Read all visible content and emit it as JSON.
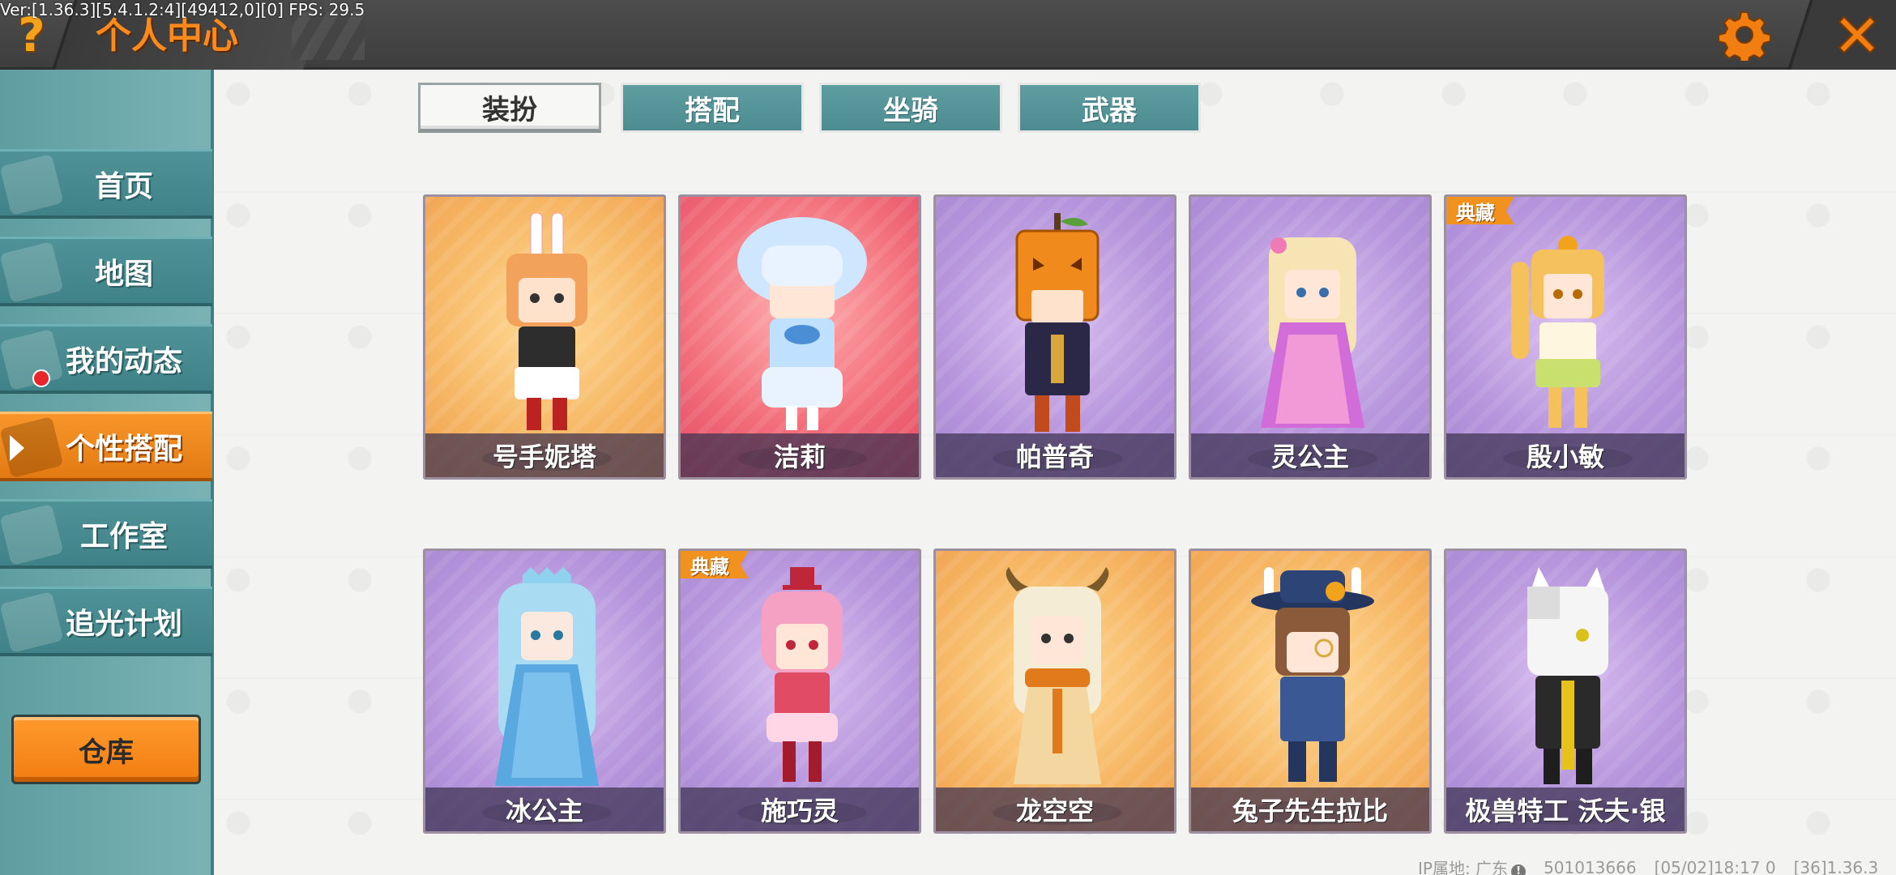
{
  "debug": "Ver:[1.36.3][5.4.1.2:4][49412,0][0] FPS: 29.5",
  "topbar": {
    "help_icon": "?",
    "title": "个人中心",
    "settings_icon": "gear-icon",
    "close_icon": "close-icon"
  },
  "sidebar": {
    "items": [
      {
        "label": "首页",
        "icon": "home-icon"
      },
      {
        "label": "地图",
        "icon": "map-icon"
      },
      {
        "label": "我的动态",
        "icon": "activity-icon"
      },
      {
        "label": "个性搭配",
        "icon": "outfit-icon",
        "active": true
      },
      {
        "label": "工作室",
        "icon": "studio-icon"
      },
      {
        "label": "追光计划",
        "icon": "plan-icon"
      }
    ],
    "warehouse_label": "仓库"
  },
  "tabs": [
    {
      "label": "装扮",
      "active": true
    },
    {
      "label": "搭配"
    },
    {
      "label": "坐骑"
    },
    {
      "label": "武器"
    }
  ],
  "cards": [
    {
      "name": "号手妮塔",
      "theme": "orange"
    },
    {
      "name": "洁莉",
      "theme": "red"
    },
    {
      "name": "帕普奇",
      "theme": "purple"
    },
    {
      "name": "灵公主",
      "theme": "purple"
    },
    {
      "name": "殷小敏",
      "theme": "purple",
      "badge": "典藏"
    },
    {
      "name": "冰公主",
      "theme": "purple"
    },
    {
      "name": "施巧灵",
      "theme": "purple",
      "badge": "典藏"
    },
    {
      "name": "龙空空",
      "theme": "orange"
    },
    {
      "name": "兔子先生拉比",
      "theme": "orange"
    },
    {
      "name": "极兽特工 沃夫·银",
      "theme": "purple"
    }
  ],
  "footer": {
    "ip": "IP属地: 广东",
    "uid": "501013666",
    "time": "[05/02]18:17 0",
    "version": "[36]1.36.3"
  },
  "colors": {
    "accent_orange": "#f7962a",
    "teal": "#4d8d91",
    "badge": "#f2921e"
  }
}
